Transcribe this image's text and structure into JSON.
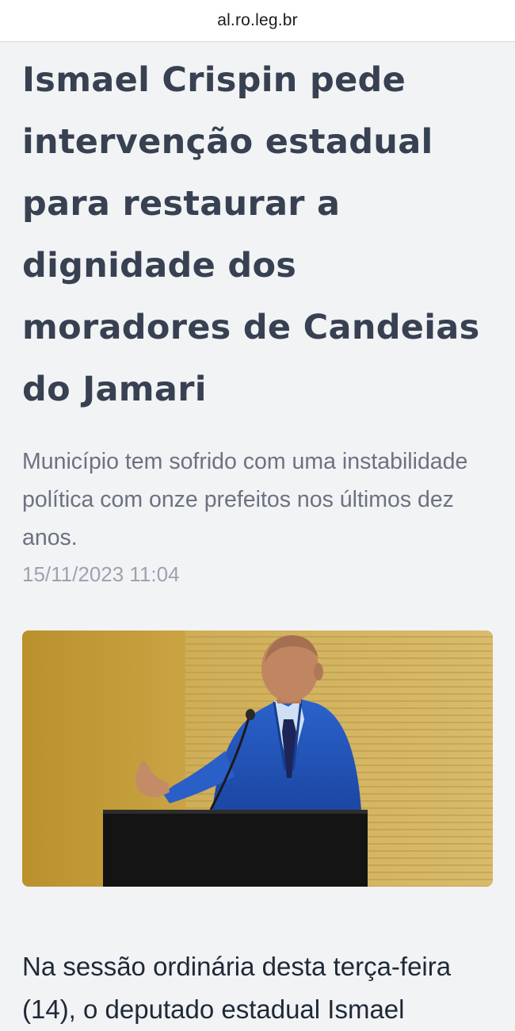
{
  "browser": {
    "url": "al.ro.leg.br"
  },
  "article": {
    "headline": "Ismael Crispin pede intervenção estadual para restaurar a dignidade dos moradores de Candeias do Jamari",
    "subtitle": "Município tem sofrido com uma instabilidade política com onze prefeitos nos últimos dez anos.",
    "date": "15/11/2023 11:04",
    "body_start": "Na sessão ordinária desta terça-feira (14), o deputado estadual Ismael"
  },
  "colors": {
    "headline": "#374151",
    "subtitle": "#6b7280",
    "date": "#9ca3af",
    "background": "#f2f3f5",
    "suit_blue": "#1f4fb4",
    "wall_yellow": "#c9a43e"
  }
}
